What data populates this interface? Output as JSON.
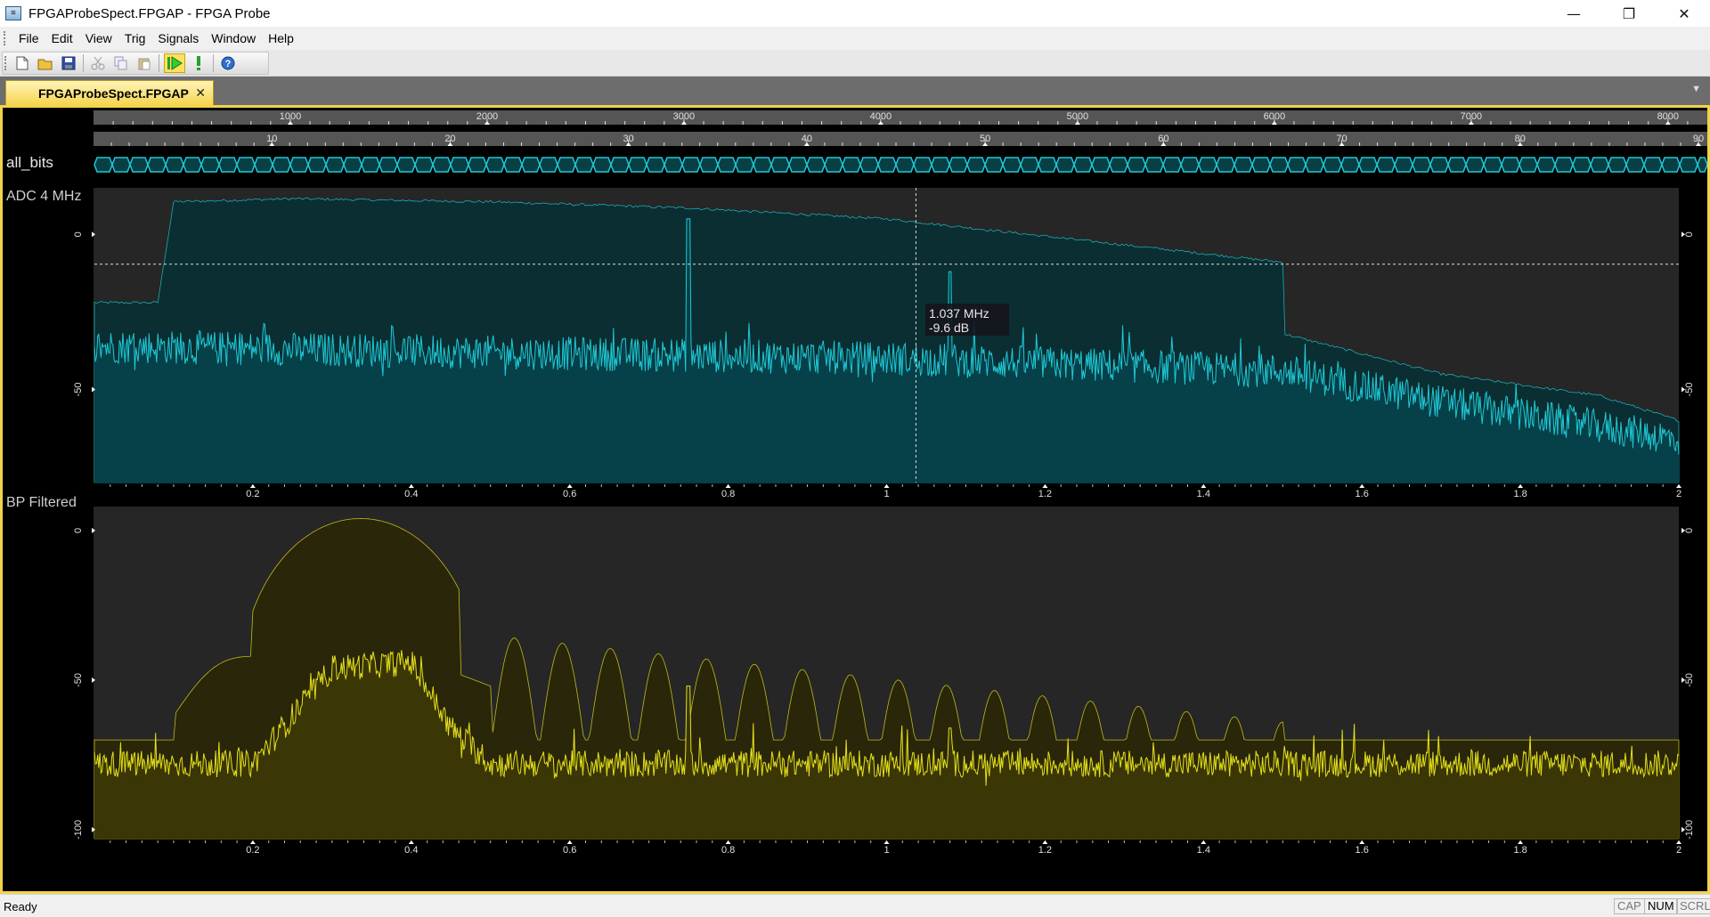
{
  "window": {
    "title": "FPGAProbeSpect.FPGAP - FPGA Probe",
    "icon": "fpga-probe-app-icon",
    "minimize_glyph": "—",
    "maximize_glyph": "❐",
    "close_glyph": "✕"
  },
  "menu": [
    "File",
    "Edit",
    "View",
    "Trig",
    "Signals",
    "Window",
    "Help"
  ],
  "toolbar": {
    "buttons": [
      "new-icon",
      "open-icon",
      "save-icon",
      "cut-icon",
      "copy-icon",
      "paste-icon",
      "run-icon",
      "stop-icon",
      "help-icon"
    ]
  },
  "tab": {
    "label": "FPGAProbeSpect.FPGAP",
    "close_glyph": "✕",
    "dropdown_glyph": "▼"
  },
  "rulers": {
    "samples_ticks": [
      "1000",
      "2000",
      "3000",
      "4000",
      "5000",
      "6000",
      "7000",
      "8000"
    ],
    "bits_ticks": [
      "10",
      "20",
      "30",
      "40",
      "50",
      "60",
      "70",
      "80",
      "90"
    ]
  },
  "signals": {
    "all_bits_label": "all_bits",
    "adc_label": "ADC 4 MHz",
    "bp_label": "BP Filtered"
  },
  "cursor": {
    "freq_text": "1.037 MHz",
    "level_text": "-9.6 dB"
  },
  "colors": {
    "adc_trace": "#1fc9d6",
    "adc_fill": "#08363b",
    "bp_trace": "#e4e01a",
    "bp_fill": "#2e2a05",
    "plot_bg": "#262626",
    "tab_accent": "#f2d34b"
  },
  "chart_data": [
    {
      "type": "line",
      "title": "ADC 4 MHz",
      "xlabel": "",
      "ylabel": "",
      "xlim": [
        0,
        2
      ],
      "ylim": [
        -80,
        15
      ],
      "x_ticks": [
        "0.2",
        "0.4",
        "0.6",
        "0.8",
        "1",
        "1.2",
        "1.4",
        "1.6",
        "1.8",
        "2"
      ],
      "y_ticks": [
        "0",
        "-50"
      ],
      "grid": false,
      "series": [
        {
          "role": "peak-hold envelope",
          "x": [
            0.0,
            0.08,
            0.1,
            0.25,
            0.5,
            0.75,
            1.0,
            1.25,
            1.5,
            1.5,
            1.7,
            1.9,
            2.0
          ],
          "y": [
            -22,
            -22,
            10.5,
            11.5,
            10.5,
            8.5,
            5,
            -2,
            -9,
            -32,
            -45,
            -52,
            -60
          ]
        },
        {
          "role": "live spectrum (mean level, noisy)",
          "x": [
            0.0,
            0.5,
            1.0,
            1.5,
            1.7,
            2.0
          ],
          "y": [
            -36,
            -38,
            -40,
            -44,
            -54,
            -66
          ]
        }
      ],
      "spikes": [
        {
          "x": 0.75,
          "y": 5
        },
        {
          "x": 1.08,
          "y": -12
        }
      ]
    },
    {
      "type": "line",
      "title": "BP Filtered",
      "xlabel": "",
      "ylabel": "",
      "xlim": [
        0,
        2
      ],
      "ylim": [
        -103,
        8
      ],
      "x_ticks": [
        "0.2",
        "0.4",
        "0.6",
        "0.8",
        "1",
        "1.2",
        "1.4",
        "1.6",
        "1.8",
        "2"
      ],
      "y_ticks": [
        "0",
        "-50",
        "-100"
      ],
      "grid": false,
      "series": [
        {
          "role": "peak-hold envelope",
          "x": [
            0.0,
            0.1,
            0.18,
            0.2,
            0.33,
            0.5,
            1.5,
            1.5,
            2.0
          ],
          "y": [
            -70,
            -70,
            -42,
            -52,
            4,
            -35,
            -64,
            -70,
            -70
          ]
        },
        {
          "role": "live spectrum (mean level, noisy)",
          "x": [
            0.0,
            0.2,
            0.3,
            0.4,
            0.45,
            0.5,
            2.0
          ],
          "y": [
            -78,
            -78,
            -46,
            -44,
            -66,
            -78,
            -78
          ]
        }
      ],
      "spikes": [
        {
          "x": 0.75,
          "y": -52
        },
        {
          "x": 1.08,
          "y": -66
        }
      ]
    }
  ]
}
